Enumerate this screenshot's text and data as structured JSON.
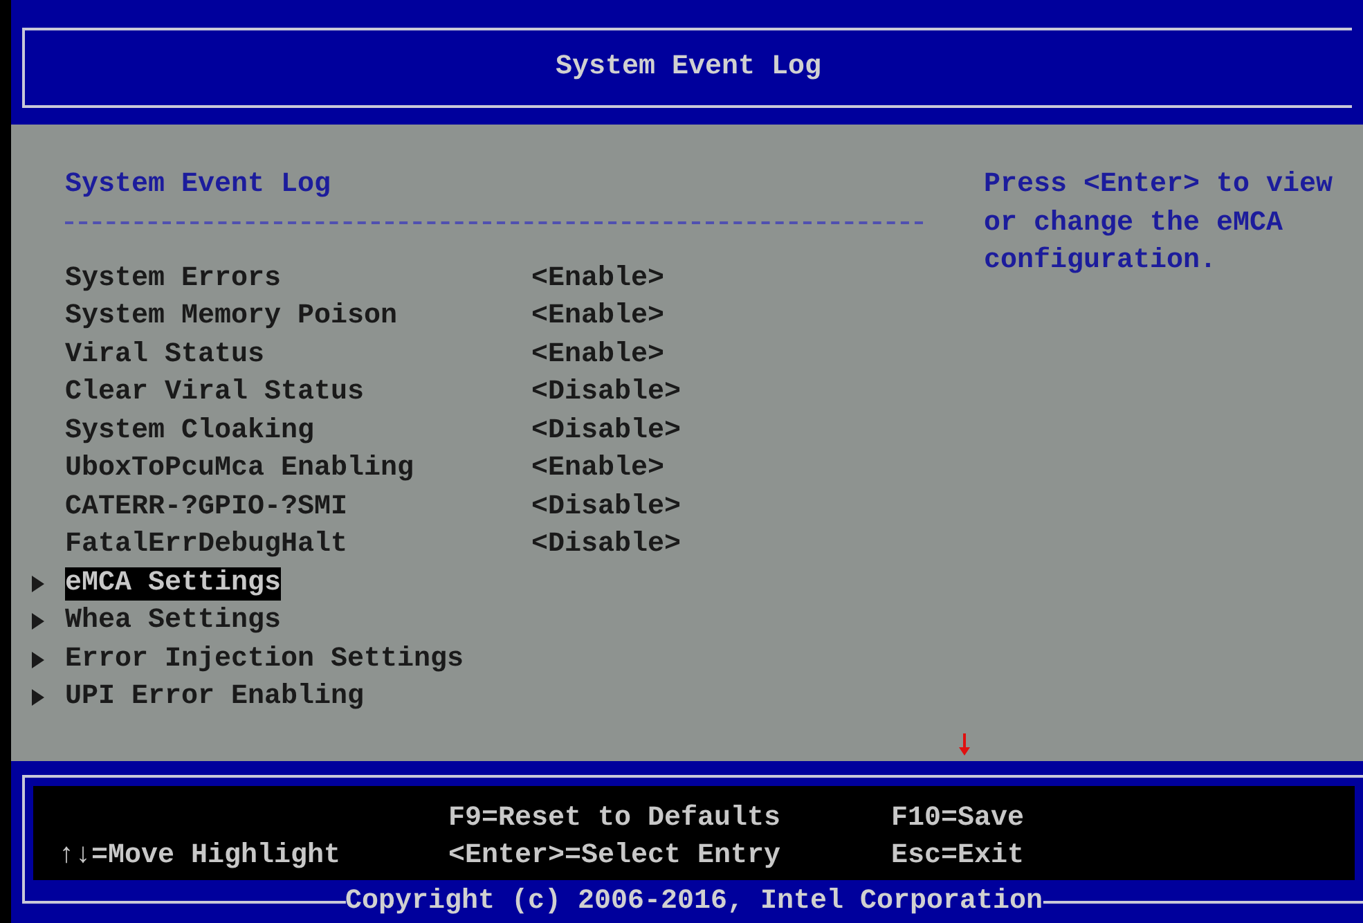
{
  "title": "System Event Log",
  "page": {
    "heading": "System Event Log",
    "items": [
      {
        "kind": "setting",
        "label": "System Errors",
        "value": "<Enable>",
        "selected": false
      },
      {
        "kind": "setting",
        "label": "System Memory Poison",
        "value": "<Enable>",
        "selected": false
      },
      {
        "kind": "setting",
        "label": "Viral Status",
        "value": "<Enable>",
        "selected": false
      },
      {
        "kind": "setting",
        "label": "Clear Viral Status",
        "value": "<Disable>",
        "selected": false
      },
      {
        "kind": "setting",
        "label": "System Cloaking",
        "value": "<Disable>",
        "selected": false
      },
      {
        "kind": "setting",
        "label": "UboxToPcuMca Enabling",
        "value": "<Enable>",
        "selected": false
      },
      {
        "kind": "setting",
        "label": "CATERR-?GPIO-?SMI",
        "value": "<Disable>",
        "selected": false
      },
      {
        "kind": "setting",
        "label": "FatalErrDebugHalt",
        "value": "<Disable>",
        "selected": false
      },
      {
        "kind": "submenu",
        "label": "eMCA Settings",
        "selected": true
      },
      {
        "kind": "submenu",
        "label": "Whea Settings",
        "selected": false
      },
      {
        "kind": "submenu",
        "label": "Error Injection Settings",
        "selected": false
      },
      {
        "kind": "submenu",
        "label": "UPI Error Enabling",
        "selected": false
      }
    ]
  },
  "help_text": "Press <Enter> to view or change the eMCA configuration.",
  "footer": {
    "columns": [
      [
        "↑↓=Move Highlight"
      ],
      [
        "F9=Reset to Defaults",
        "<Enter>=Select Entry"
      ],
      [
        "F10=Save",
        "Esc=Exit"
      ]
    ]
  },
  "copyright": "Copyright (c) 2006-2016, Intel Corporation"
}
